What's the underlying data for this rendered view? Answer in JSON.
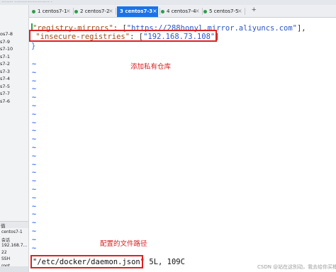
{
  "top_strip": "…….  ………………… .",
  "sidebar": {
    "sessions": [
      "os7-8",
      "s7-9",
      "s7-10",
      "s7-1",
      "s7-2",
      "s7-3",
      "s7-4",
      "s7-5",
      "s7-7",
      "s7-6"
    ],
    "properties_header": "值",
    "properties": [
      "centos7-1",
      "会话",
      "192.168.7...",
      "22",
      "SSH",
      "root"
    ]
  },
  "tabs": [
    {
      "number": "1",
      "label": "centos7-1",
      "active": false
    },
    {
      "number": "2",
      "label": "centos7-2",
      "active": false
    },
    {
      "number": "3",
      "label": "centos7-3",
      "active": true
    },
    {
      "number": "4",
      "label": "centos7-4",
      "active": false
    },
    {
      "number": "5",
      "label": "centos7-5",
      "active": false
    }
  ],
  "tab_close_glyph": "×",
  "new_tab_glyph": "+",
  "terminal": {
    "line1_open": "{",
    "line1_key": "\"registry-mirrors\"",
    "line1_sep": ": [",
    "line1_value": "\"https://288honyl.mirror.aliyuncs.com\"",
    "line1_end": "],",
    "line2_key": "\"insecure-registries\"",
    "line2_sep": ": [",
    "line2_value": "\"192.168.73.108\"",
    "line2_end": "]",
    "line3": "}",
    "tilde": "~",
    "status_file": "\"/etc/docker/daemon.json\"",
    "status_info": " 5L, 109C"
  },
  "annotations": {
    "add_registry": "添加私有仓库",
    "config_path": "配置的文件路径"
  },
  "colors": {
    "annotation_red": "#e02020",
    "tilde_blue": "#3a6ee8",
    "active_tab_blue": "#1a73e8",
    "status_dot_green": "#2e9e47"
  },
  "watermark": "CSDN @站在这别动，我去给你买橘子"
}
